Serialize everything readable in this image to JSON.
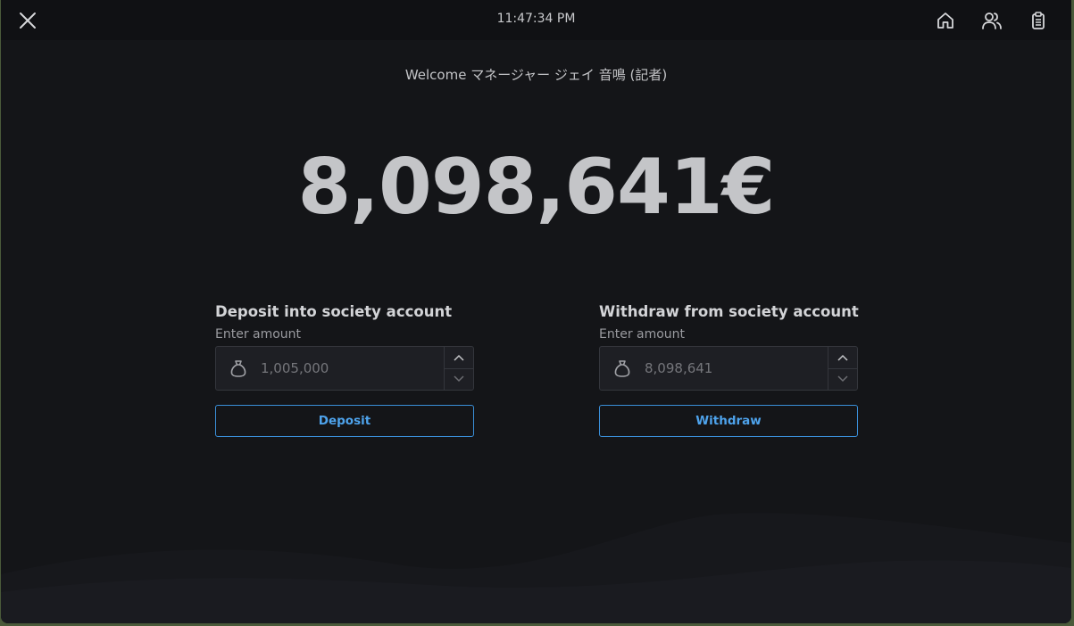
{
  "header": {
    "time": "11:47:34 PM",
    "close_icon": "close-icon",
    "home_icon": "home-icon",
    "users_icon": "users-icon",
    "clipboard_icon": "clipboard-icon"
  },
  "welcome_text": "Welcome マネージャー ジェイ 音鳴 (記者)",
  "balance": "8,098,641€",
  "deposit": {
    "title": "Deposit into society account",
    "label": "Enter amount",
    "placeholder": "1,005,000",
    "button_label": "Deposit",
    "icon": "money-bag-icon"
  },
  "withdraw": {
    "title": "Withdraw from society account",
    "label": "Enter amount",
    "placeholder": "8,098,641",
    "button_label": "Withdraw",
    "icon": "money-bag-icon"
  },
  "colors": {
    "background": "#141518",
    "topbar": "#101114",
    "accent": "#4ea3ec",
    "text": "#c4c5c8"
  }
}
